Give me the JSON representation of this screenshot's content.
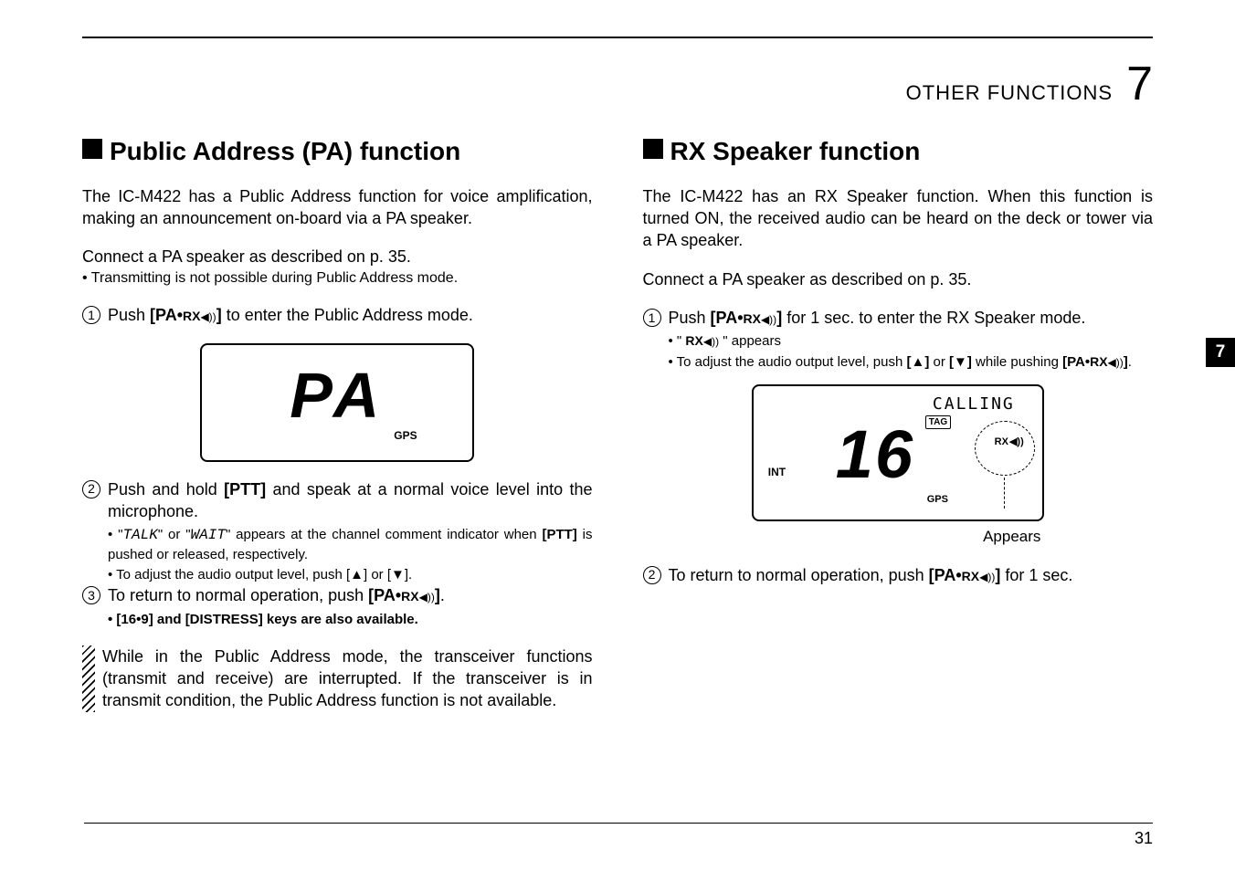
{
  "header": {
    "section": "OTHER FUNCTIONS",
    "chapter": "7"
  },
  "tab": "7",
  "left": {
    "title": "Public Address (PA) function",
    "intro": "The IC-M422 has a Public Address function for voice amplification, making an announcement on-board via a PA speaker.",
    "connect": "Connect a PA speaker as described on p. 35.",
    "connect_bullet": "• Transmitting is not possible during Public Address mode.",
    "step1_a": "Push ",
    "step1_b": "[PA•",
    "step1_c": " to enter the Public Address mode.",
    "lcd_pa": "PA",
    "gps_label": "GPS",
    "step2_a": "Push and hold ",
    "step2_b": "[PTT]",
    "step2_c": " and speak at a normal voice level into the microphone.",
    "step2_sub1_a": "• \"",
    "step2_sub1_b": "TALK",
    "step2_sub1_c": "\" or \"",
    "step2_sub1_d": "WAIT",
    "step2_sub1_e": "\" appears at the channel comment indicator when ",
    "step2_sub1_f": "[PTT]",
    "step2_sub1_g": " is pushed or released, respectively.",
    "step2_sub2": "• To adjust the audio output level, push [▲] or [▼].",
    "step3_a": "To return to normal operation, push ",
    "step3_b": "[PA•",
    "step3_c": ".",
    "step3_sub": "• [16•9] and [DISTRESS] keys are also available.",
    "note": "While in the Public Address mode, the transceiver functions (transmit and receive) are interrupted. If the transceiver is in transmit condition, the Public Address function is not available."
  },
  "right": {
    "title": "RX Speaker function",
    "intro": "The IC-M422 has an RX Speaker function. When this function is turned ON, the received audio can be heard on the deck or tower via a PA speaker.",
    "connect": "Connect a PA speaker as described on p. 35.",
    "step1_a": "Push ",
    "step1_b": "[PA•",
    "step1_c": " for 1 sec. to enter the RX Speaker mode.",
    "step1_sub1_a": "• \" ",
    "step1_sub1_b": "RX",
    "step1_sub1_c": " \" appears",
    "step1_sub2_a": "• To adjust the audio output level, push ",
    "step1_sub2_b": "[▲]",
    "step1_sub2_c": " or ",
    "step1_sub2_d": "[▼]",
    "step1_sub2_e": " while pushing ",
    "step1_sub2_f": "[PA•",
    "step1_sub2_g": ".",
    "lcd_calling": "CALLING",
    "lcd_tag": "TAG",
    "lcd_channel": "16",
    "lcd_gps": "GPS",
    "lcd_int": "INT",
    "lcd_rx": "RX",
    "appears": "Appears",
    "step2_a": "To return to normal operation, push ",
    "step2_b": "[PA•",
    "step2_c": " for 1 sec."
  },
  "page_number": "31",
  "key_rx": "RX"
}
